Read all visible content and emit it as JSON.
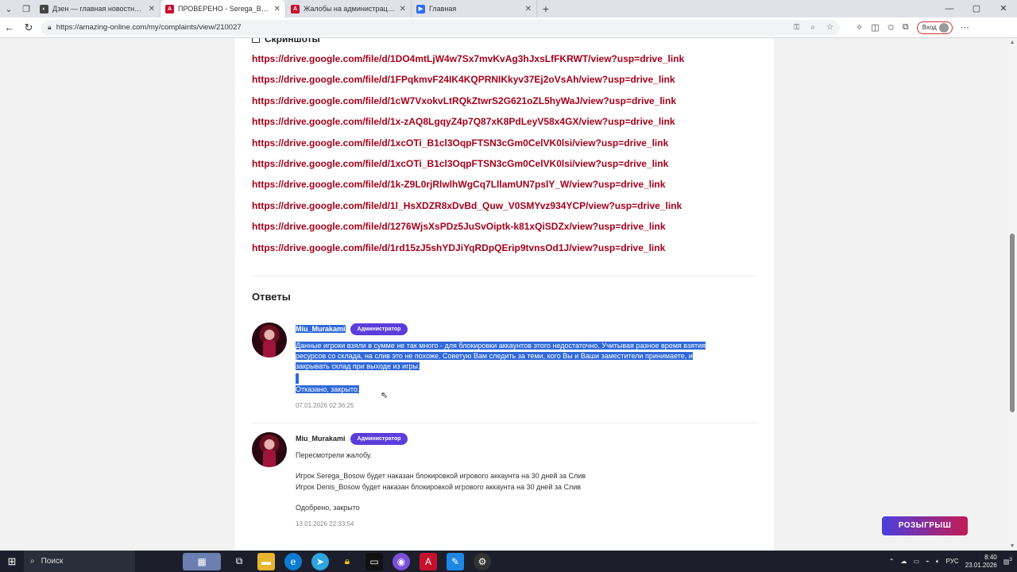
{
  "browser": {
    "tabs": [
      {
        "title": "Дзен — главная новостная инф",
        "fav_color": "#444444",
        "fav_glyph": "◐"
      },
      {
        "title": "ПРОВЕРЕНО - Serega_Bosow, De",
        "fav_color": "#c8102e",
        "fav_glyph": "A"
      },
      {
        "title": "Жалобы на администрацию - А",
        "fav_color": "#c8102e",
        "fav_glyph": "A"
      },
      {
        "title": "Главная",
        "fav_color": "#2f6df5",
        "fav_glyph": "▶"
      }
    ],
    "url": "https://amazing-online.com/my/complaints/view/210027",
    "login_label": "Вход"
  },
  "screenshots": {
    "title": "Скриншоты",
    "links": [
      "https://drive.google.com/file/d/1DO4mtLjW4w7Sx7mvKvAg3hJxsLfFKRWT/view?usp=drive_link",
      "https://drive.google.com/file/d/1FPqkmvF24IK4KQPRNIKkyv37Ej2oVsAh/view?usp=drive_link",
      "https://drive.google.com/file/d/1cW7VxokvLtRQkZtwrS2G621oZL5hyWaJ/view?usp=drive_link",
      "https://drive.google.com/file/d/1x-zAQ8LgqyZ4p7Q87xK8PdLeyV58x4GX/view?usp=drive_link",
      "https://drive.google.com/file/d/1xcOTi_B1cl3OqpFTSN3cGm0CelVK0lsi/view?usp=drive_link",
      "https://drive.google.com/file/d/1xcOTi_B1cl3OqpFTSN3cGm0CelVK0lsi/view?usp=drive_link",
      "https://drive.google.com/file/d/1k-Z9L0rjRlwlhWgCq7LllamUN7pslY_W/view?usp=drive_link",
      "https://drive.google.com/file/d/1l_HsXDZR8xDvBd_Quw_V0SMYvz934YCP/view?usp=drive_link",
      "https://drive.google.com/file/d/1276WjsXsPDz5JuSvOiptk-k81xQiSDZx/view?usp=drive_link",
      "https://drive.google.com/file/d/1rd15zJ5shYDJiYqRDpQErip9tvnsOd1J/view?usp=drive_link"
    ]
  },
  "answers": {
    "title": "Ответы",
    "items": [
      {
        "author": "Miu_Murakami",
        "role": "Администратор",
        "lines": [
          "Данные игроки взяли в сумме не так много - для блокировки аккаунтов этого недостаточно. Учитывая разное время взятия",
          "ресурсов со склада, на слив это не похоже. Советую Вам следить за теми, кого Вы и Ваши заместители принимаете, и",
          "закрывать склад при выходе из игры.",
          "",
          "Отказано, закрыто."
        ],
        "date": "07.01.2026 02:36:25",
        "selected": true
      },
      {
        "author": "Miu_Murakami",
        "role": "Администратор",
        "lines": [
          "Пересмотрели жалобу.",
          "",
          "Игрок Serega_Bosow будет наказан блокировкой игрового аккаунта на 30 дней за Слив",
          "Игрок Denis_Bosow будет наказан блокировкой игрового аккаунта на 30 дней за Слив",
          "",
          "Одобрено, закрыто"
        ],
        "date": "13.01.2026 22:33:54",
        "selected": false
      }
    ]
  },
  "promo_button": "РОЗЫГРЫШ",
  "taskbar": {
    "search_label": "Поиск",
    "language": "РУС",
    "time": "8:40",
    "date": "23.01.2026",
    "notification_count": "3"
  }
}
